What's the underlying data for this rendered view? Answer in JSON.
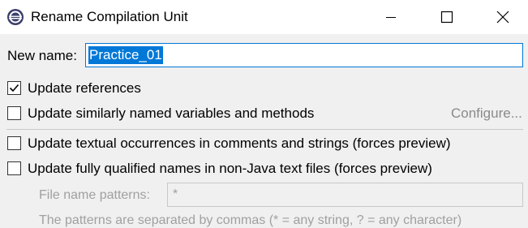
{
  "window": {
    "title": "Rename Compilation Unit",
    "app_icon": "eclipse-icon",
    "controls": [
      "minimize-icon",
      "maximize-icon",
      "close-icon"
    ]
  },
  "form": {
    "new_name_label": "New name:",
    "new_name_value": "Practice_01",
    "options": [
      {
        "label": "Update references",
        "checked": true,
        "enabled": true
      },
      {
        "label": "Update similarly named variables and methods",
        "checked": false,
        "enabled": true
      },
      {
        "label": "Update textual occurrences in comments and strings (forces preview)",
        "checked": false,
        "enabled": true
      },
      {
        "label": "Update fully qualified names in non-Java text files (forces preview)",
        "checked": false,
        "enabled": true
      }
    ],
    "configure_label": "Configure...",
    "file_patterns_label": "File name patterns:",
    "file_patterns_value": "*",
    "patterns_hint": "The patterns are separated by commas (* = any string, ? = any character)"
  },
  "colors": {
    "selection": "#0078d7",
    "background": "#f0f0f0",
    "disabled_text": "#a0a0a0"
  }
}
